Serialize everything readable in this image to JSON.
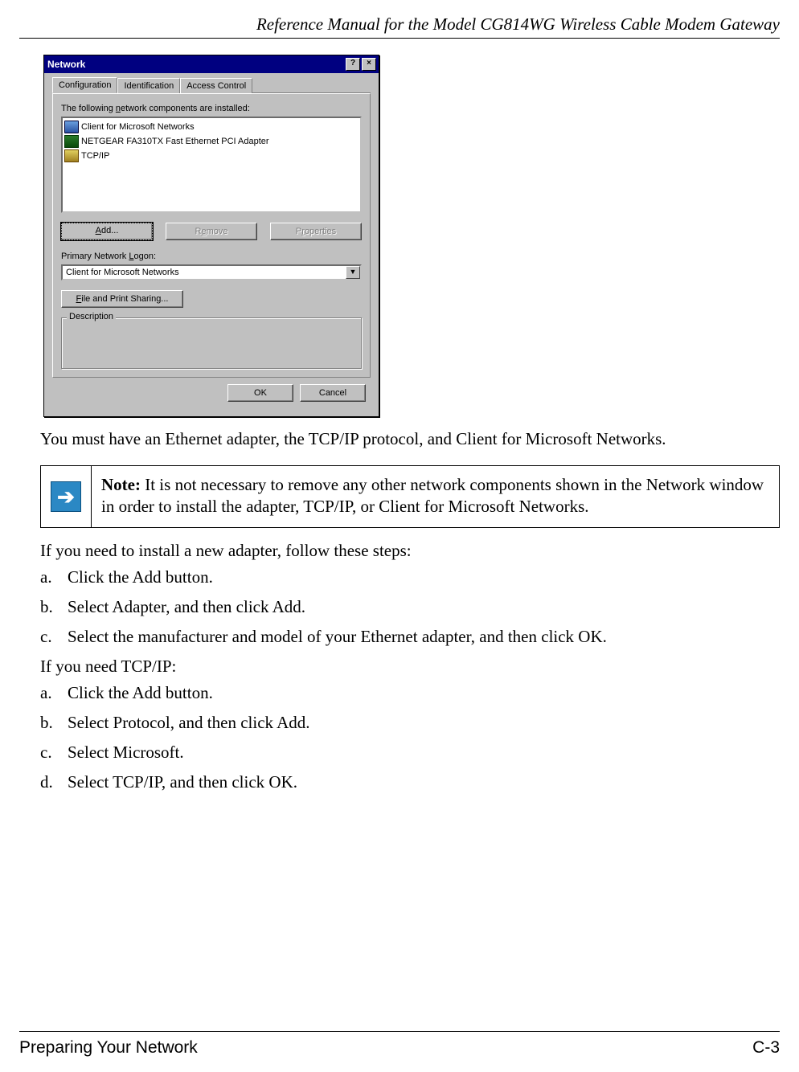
{
  "header": {
    "title": "Reference Manual for the Model CG814WG Wireless Cable Modem Gateway"
  },
  "dialog": {
    "title": "Network",
    "help_btn": "?",
    "close_btn": "×",
    "tabs": {
      "configuration": "Configuration",
      "identification": "Identification",
      "access_control": "Access Control"
    },
    "components_label_pre": "The following ",
    "components_label_underline": "n",
    "components_label_post": "etwork components are installed:",
    "components": [
      "Client for Microsoft Networks",
      "NETGEAR FA310TX Fast Ethernet PCI Adapter",
      "TCP/IP"
    ],
    "buttons": {
      "add_underline": "A",
      "add_post": "dd...",
      "remove_pre": "R",
      "remove_underline": "e",
      "remove_post": "move",
      "properties_pre": "P",
      "properties_underline": "r",
      "properties_post": "operties"
    },
    "primary_logon_label_pre": "Primary Network ",
    "primary_logon_label_underline": "L",
    "primary_logon_label_post": "ogon:",
    "primary_logon_value": "Client for Microsoft Networks",
    "fps_underline": "F",
    "fps_post": "ile and Print Sharing...",
    "description_label": "Description",
    "ok": "OK",
    "cancel": "Cancel"
  },
  "body": {
    "intro": "You must have an Ethernet adapter, the TCP/IP protocol, and Client for Microsoft Networks."
  },
  "note": {
    "bold": "Note:",
    "text": " It is not necessary to remove any other network components shown in the Network window in order to install the adapter, TCP/IP, or Client for Microsoft Networks."
  },
  "steps": {
    "adapter_intro": "If you need to install a new adapter, follow these steps:",
    "adapter": [
      {
        "marker": "a.",
        "text": "Click the Add button."
      },
      {
        "marker": "b.",
        "text": "Select Adapter, and then click Add."
      },
      {
        "marker": "c.",
        "text": "Select the manufacturer and model of your Ethernet adapter, and then click OK."
      }
    ],
    "tcpip_intro": "If you need TCP/IP:",
    "tcpip": [
      {
        "marker": "a.",
        "text": "Click the Add button."
      },
      {
        "marker": "b.",
        "text": "Select Protocol, and then click Add."
      },
      {
        "marker": "c.",
        "text": "Select Microsoft."
      },
      {
        "marker": "d.",
        "text": "Select TCP/IP, and then click OK."
      }
    ]
  },
  "footer": {
    "left": "Preparing Your Network",
    "right": "C-3"
  }
}
